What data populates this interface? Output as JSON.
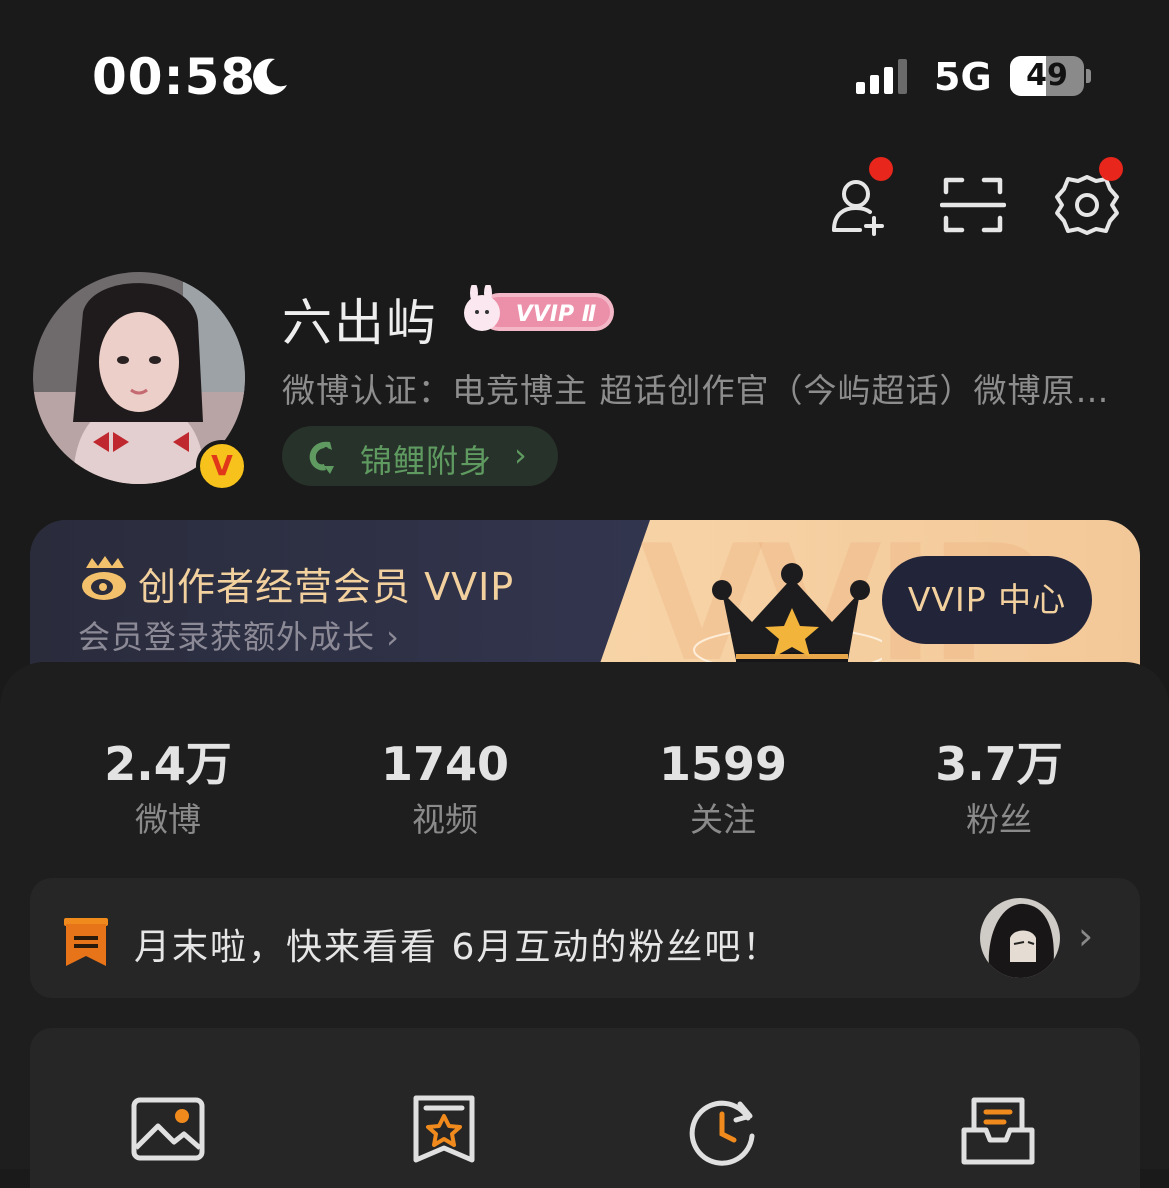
{
  "status_bar": {
    "time": "00:58",
    "network": "5G",
    "battery": "49",
    "battery_level": 0.49
  },
  "profile": {
    "name": "六出屿",
    "member_badge": "VVIP Ⅱ",
    "verification": "微博认证：电竞博主 超话创作官（今屿超话）微博原…",
    "verified_mark": "V",
    "luck_label": "锦鲤附身",
    "luck_chevron": "›"
  },
  "vip_banner": {
    "title": "创作者经营会员 VVIP",
    "subtitle": "会员登录获额外成长 ›",
    "watermark": "VVIP",
    "button": "VVIP 中心"
  },
  "stats": [
    {
      "value": "2.4万",
      "label": "微博"
    },
    {
      "value": "1740",
      "label": "视频"
    },
    {
      "value": "1599",
      "label": "关注"
    },
    {
      "value": "3.7万",
      "label": "粉丝"
    }
  ],
  "notice": {
    "text": "月末啦，快来看看 6月互动的粉丝吧！",
    "chevron": "›"
  },
  "icons": {
    "top": [
      "add-friend-icon",
      "scan-icon",
      "settings-icon"
    ],
    "tools": [
      "album-icon",
      "favorites-icon",
      "history-icon",
      "drafts-icon"
    ]
  },
  "colors": {
    "background": "#1a1a1a",
    "accent_red": "#e8261c",
    "vip_gold": "#f3d19e",
    "luck_green": "#5f9a61",
    "tool_orange": "#f08a1c"
  }
}
